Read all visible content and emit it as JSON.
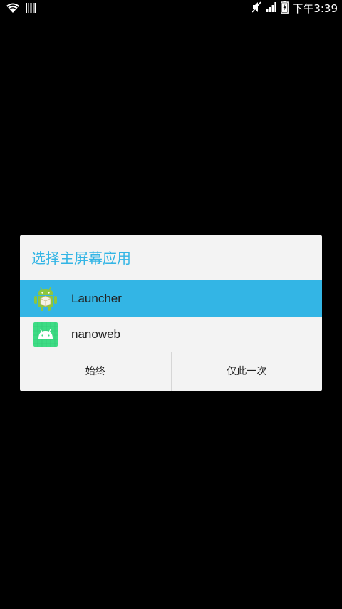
{
  "status_bar": {
    "time": "下午3:39",
    "icons": [
      "wifi-icon",
      "barcode-icon",
      "mute-icon",
      "signal-icon",
      "battery-charging-icon"
    ]
  },
  "dialog": {
    "title": "选择主屏幕应用",
    "accent_color": "#33b5e5",
    "items": [
      {
        "label": "Launcher",
        "icon": "android-launcher-icon",
        "selected": true
      },
      {
        "label": "nanoweb",
        "icon": "android-app-icon",
        "selected": false
      }
    ],
    "buttons": {
      "always": "始终",
      "just_once": "仅此一次"
    }
  }
}
